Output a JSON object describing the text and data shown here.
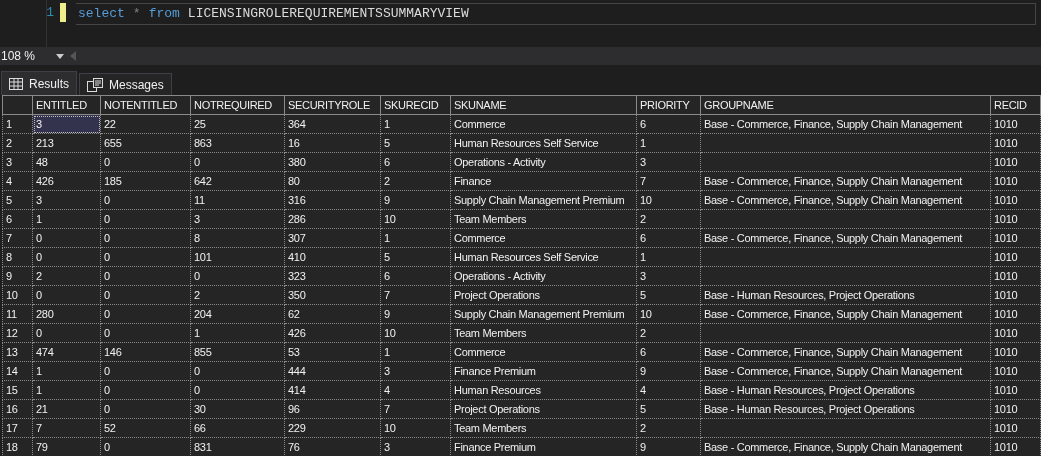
{
  "editor": {
    "lines": [
      {
        "number": "1",
        "tokens": [
          {
            "kind": "keyword",
            "text": "select"
          },
          {
            "kind": "operator",
            "text": "*"
          },
          {
            "kind": "keyword",
            "text": "from"
          },
          {
            "kind": "identifier",
            "text": "LICENSINGROLEREQUIREMENTSSUMMARYVIEW"
          }
        ]
      }
    ]
  },
  "zoom": "108 %",
  "tabs": [
    {
      "label": "Results",
      "kind": "grid",
      "selected": true
    },
    {
      "label": "Messages",
      "kind": "messages",
      "selected": false
    }
  ],
  "table": {
    "columns": [
      "ENTITLED",
      "NOTENTITLED",
      "NOTREQUIRED",
      "SECURITYROLE",
      "SKURECID",
      "SKUNAME",
      "PRIORITY",
      "GROUPNAME",
      "RECID"
    ],
    "rows": [
      {
        "number": "1",
        "selected": true,
        "cells": [
          "3",
          "22",
          "25",
          "364",
          "1",
          "Commerce",
          "6",
          "Base - Commerce, Finance, Supply Chain Management",
          "1010"
        ]
      },
      {
        "number": "2",
        "selected": false,
        "cells": [
          "213",
          "655",
          "863",
          "16",
          "5",
          "Human Resources Self Service",
          "1",
          "",
          "1010"
        ]
      },
      {
        "number": "3",
        "selected": false,
        "cells": [
          "48",
          "0",
          "0",
          "380",
          "6",
          "Operations - Activity",
          "3",
          "",
          "1010"
        ]
      },
      {
        "number": "4",
        "selected": false,
        "cells": [
          "426",
          "185",
          "642",
          "80",
          "2",
          "Finance",
          "7",
          "Base - Commerce, Finance, Supply Chain Management",
          "1010"
        ]
      },
      {
        "number": "5",
        "selected": false,
        "cells": [
          "3",
          "0",
          "11",
          "316",
          "9",
          "Supply Chain Management Premium",
          "10",
          "Base - Commerce, Finance, Supply Chain Management",
          "1010"
        ]
      },
      {
        "number": "6",
        "selected": false,
        "cells": [
          "1",
          "0",
          "3",
          "286",
          "10",
          "Team Members",
          "2",
          "",
          "1010"
        ]
      },
      {
        "number": "7",
        "selected": false,
        "cells": [
          "0",
          "0",
          "8",
          "307",
          "1",
          "Commerce",
          "6",
          "Base - Commerce, Finance, Supply Chain Management",
          "1010"
        ]
      },
      {
        "number": "8",
        "selected": false,
        "cells": [
          "0",
          "0",
          "101",
          "410",
          "5",
          "Human Resources Self Service",
          "1",
          "",
          "1010"
        ]
      },
      {
        "number": "9",
        "selected": false,
        "cells": [
          "2",
          "0",
          "0",
          "323",
          "6",
          "Operations - Activity",
          "3",
          "",
          "1010"
        ]
      },
      {
        "number": "10",
        "selected": false,
        "cells": [
          "0",
          "0",
          "2",
          "350",
          "7",
          "Project Operations",
          "5",
          "Base - Human Resources, Project Operations",
          "1010"
        ]
      },
      {
        "number": "11",
        "selected": false,
        "cells": [
          "280",
          "0",
          "204",
          "62",
          "9",
          "Supply Chain Management Premium",
          "10",
          "Base - Commerce, Finance, Supply Chain Management",
          "1010"
        ]
      },
      {
        "number": "12",
        "selected": false,
        "cells": [
          "0",
          "0",
          "1",
          "426",
          "10",
          "Team Members",
          "2",
          "",
          "1010"
        ]
      },
      {
        "number": "13",
        "selected": false,
        "cells": [
          "474",
          "146",
          "855",
          "53",
          "1",
          "Commerce",
          "6",
          "Base - Commerce, Finance, Supply Chain Management",
          "1010"
        ]
      },
      {
        "number": "14",
        "selected": false,
        "cells": [
          "1",
          "0",
          "0",
          "444",
          "3",
          "Finance Premium",
          "9",
          "Base - Commerce, Finance, Supply Chain Management",
          "1010"
        ]
      },
      {
        "number": "15",
        "selected": false,
        "cells": [
          "1",
          "0",
          "0",
          "414",
          "4",
          "Human Resources",
          "4",
          "Base - Human Resources, Project Operations",
          "1010"
        ]
      },
      {
        "number": "16",
        "selected": false,
        "cells": [
          "21",
          "0",
          "30",
          "96",
          "7",
          "Project Operations",
          "5",
          "Base - Human Resources, Project Operations",
          "1010"
        ]
      },
      {
        "number": "17",
        "selected": false,
        "cells": [
          "7",
          "52",
          "66",
          "229",
          "10",
          "Team Members",
          "2",
          "",
          "1010"
        ]
      },
      {
        "number": "18",
        "selected": false,
        "cells": [
          "79",
          "0",
          "831",
          "76",
          "3",
          "Finance Premium",
          "9",
          "Base - Commerce, Finance, Supply Chain Management",
          "1010"
        ]
      }
    ]
  }
}
